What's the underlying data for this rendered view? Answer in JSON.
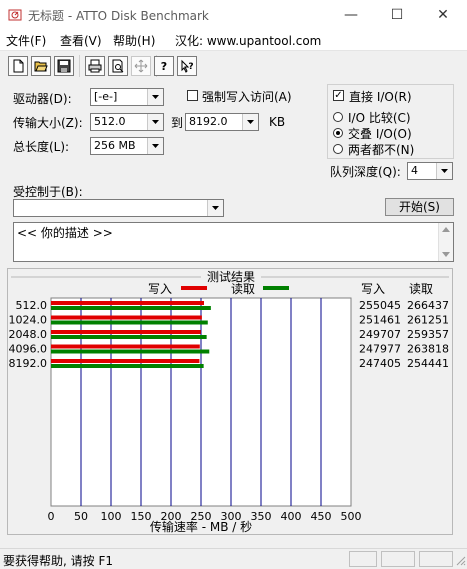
{
  "window": {
    "title": "无标题 - ATTO Disk Benchmark",
    "minimize": "—",
    "maximize": "☐",
    "close": "✕"
  },
  "menu": [
    {
      "label": "文件(F)"
    },
    {
      "label": "查看(V)"
    },
    {
      "label": "帮助(H)"
    },
    {
      "label": "汉化: www.upantool.com"
    }
  ],
  "toolbar": [
    "new-icon",
    "open-icon",
    "save-icon",
    "print-icon",
    "print-preview-icon",
    "move-icon",
    "help-icon",
    "context-help-icon"
  ],
  "form": {
    "drive_label": "驱动器(D):",
    "drive_value": "[-e-]",
    "force_write_label": "强制写入访问(A)",
    "transfer_size_label": "传输大小(Z):",
    "transfer_from": "512.0",
    "to_label": "到",
    "transfer_to": "8192.0",
    "kb_label": "KB",
    "total_length_label": "总长度(L):",
    "total_length_value": "256 MB",
    "direct_io_label": "直接 I/O(R)",
    "io_compare_label": "I/O 比较(C)",
    "overlapped_io_label": "交叠 I/O(O)",
    "neither_label": "两者都不(N)",
    "queue_depth_label": "队列深度(Q):",
    "queue_depth_value": "4",
    "controlled_by_label": "受控制于(B):",
    "controlled_by_value": "",
    "start_button": "开始(S)",
    "description_text": "<<  你的描述   >>"
  },
  "results": {
    "title": "测试结果",
    "legend_write": "写入",
    "legend_read": "读取",
    "col_write": "写入",
    "col_read": "读取",
    "rows": [
      {
        "size": "512.0",
        "write": "255045",
        "read": "266437"
      },
      {
        "size": "1024.0",
        "write": "251461",
        "read": "261251"
      },
      {
        "size": "2048.0",
        "write": "249707",
        "read": "259357"
      },
      {
        "size": "4096.0",
        "write": "247977",
        "read": "263818"
      },
      {
        "size": "8192.0",
        "write": "247405",
        "read": "254441"
      }
    ]
  },
  "chart_data": {
    "type": "bar",
    "orientation": "horizontal",
    "categories": [
      "512.0",
      "1024.0",
      "2048.0",
      "4096.0",
      "8192.0"
    ],
    "series": [
      {
        "name": "写入",
        "color": "#e00000",
        "values": [
          255.0,
          251.5,
          249.7,
          248.0,
          247.4
        ]
      },
      {
        "name": "读取",
        "color": "#008000",
        "values": [
          266.4,
          261.3,
          259.4,
          263.8,
          254.4
        ]
      }
    ],
    "xlabel": "传输速率 - MB / 秒",
    "xlim": [
      0,
      500
    ],
    "xticks": [
      "0",
      "50",
      "100",
      "150",
      "200",
      "250",
      "300",
      "350",
      "400",
      "450",
      "500"
    ],
    "grid": true,
    "legend": "top"
  },
  "status": {
    "text": "要获得帮助, 请按 F1"
  },
  "colors": {
    "write": "#e00000",
    "read": "#008000",
    "grid": "#00008b"
  }
}
